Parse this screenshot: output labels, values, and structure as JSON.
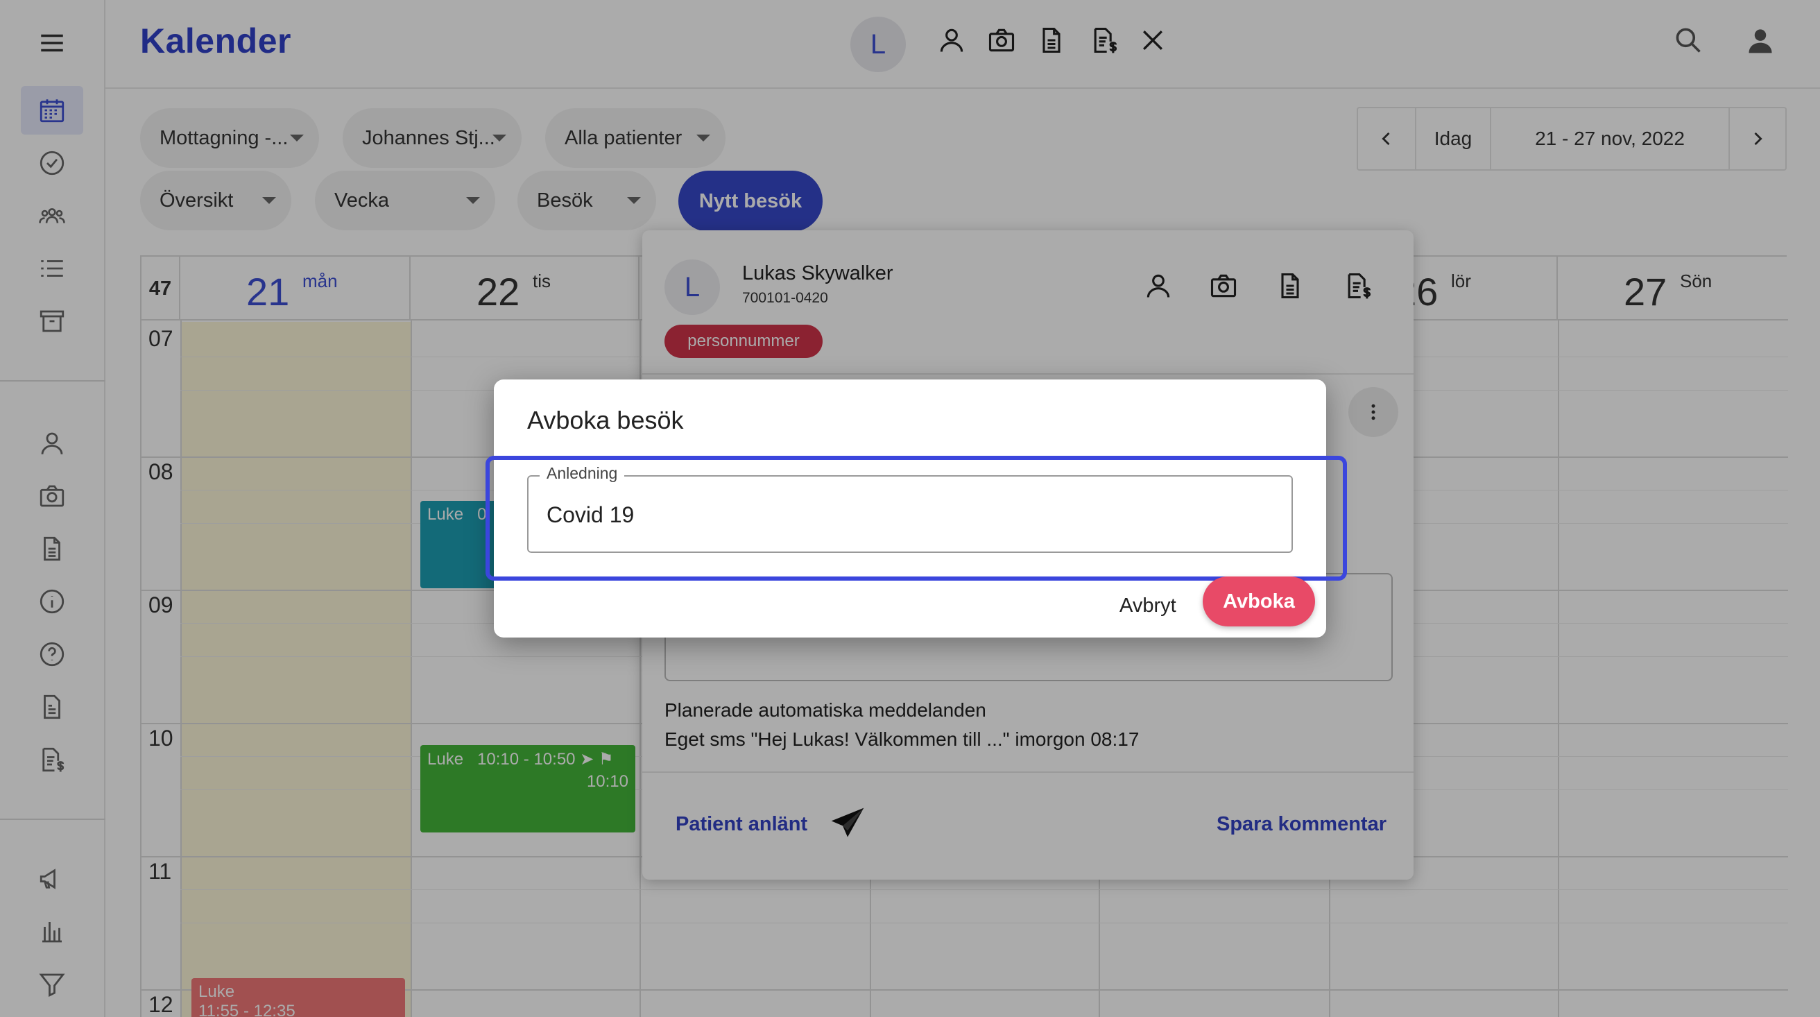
{
  "app": {
    "title": "Kalender"
  },
  "topbar": {
    "avatar_letter": "L"
  },
  "filters": {
    "mottagning": "Mottagning -...",
    "provider": "Johannes Stj...",
    "patients": "Alla patienter",
    "view": "Översikt",
    "range": "Vecka",
    "type": "Besök",
    "new_visit": "Nytt besök"
  },
  "datenav": {
    "today": "Idag",
    "range": "21 - 27 nov, 2022"
  },
  "calendar": {
    "week_number": "47",
    "days": [
      {
        "num": "21",
        "name": "mån"
      },
      {
        "num": "22",
        "name": "tis"
      },
      {
        "num": "26",
        "name": "lör"
      },
      {
        "num": "27",
        "name": "Sön"
      }
    ],
    "hours": [
      "07",
      "08",
      "09",
      "10",
      "11",
      "12"
    ],
    "events": [
      {
        "title": "Luke",
        "time": "0"
      },
      {
        "title": "Luke",
        "time": "10:10 - 10:50",
        "time_end": "10:10"
      },
      {
        "title": "Luke",
        "time": "11:55 - 12:35"
      }
    ]
  },
  "patient_card": {
    "avatar_letter": "L",
    "name": "Lukas Skywalker",
    "personnummer": "700101-0420",
    "tag": "personnummer",
    "planned_heading": "Planerade automatiska meddelanden",
    "planned_item": "Eget sms \"Hej Lukas! Välkommen till ...\" imorgon 08:17",
    "arrived_label": "Patient anlänt",
    "save_comment_label": "Spara kommentar"
  },
  "dialog": {
    "title": "Avboka besök",
    "field_label": "Anledning",
    "field_value": "Covid 19",
    "cancel_label": "Avbryt",
    "confirm_label": "Avboka"
  },
  "colors": {
    "brand": "#3040c8",
    "primary_button": "#3748c9",
    "danger": "#e84a67",
    "tag": "#d0334a",
    "highlight": "#3b46dd",
    "event_teal": "#1d9fb3",
    "event_green": "#43b53a",
    "event_red": "#f07878"
  },
  "icons": {
    "sidebar": [
      "menu-icon",
      "calendar-icon",
      "check-circle-icon",
      "group-icon",
      "list-icon",
      "archive-icon",
      "person-icon",
      "camera-icon",
      "document-icon",
      "info-icon",
      "help-icon",
      "report-icon",
      "invoice-icon",
      "megaphone-icon",
      "bar-chart-icon",
      "filter-icon"
    ],
    "topbar": [
      "person-icon",
      "camera-icon",
      "document-icon",
      "invoice-icon",
      "close-icon",
      "search-icon",
      "account-icon"
    ]
  }
}
